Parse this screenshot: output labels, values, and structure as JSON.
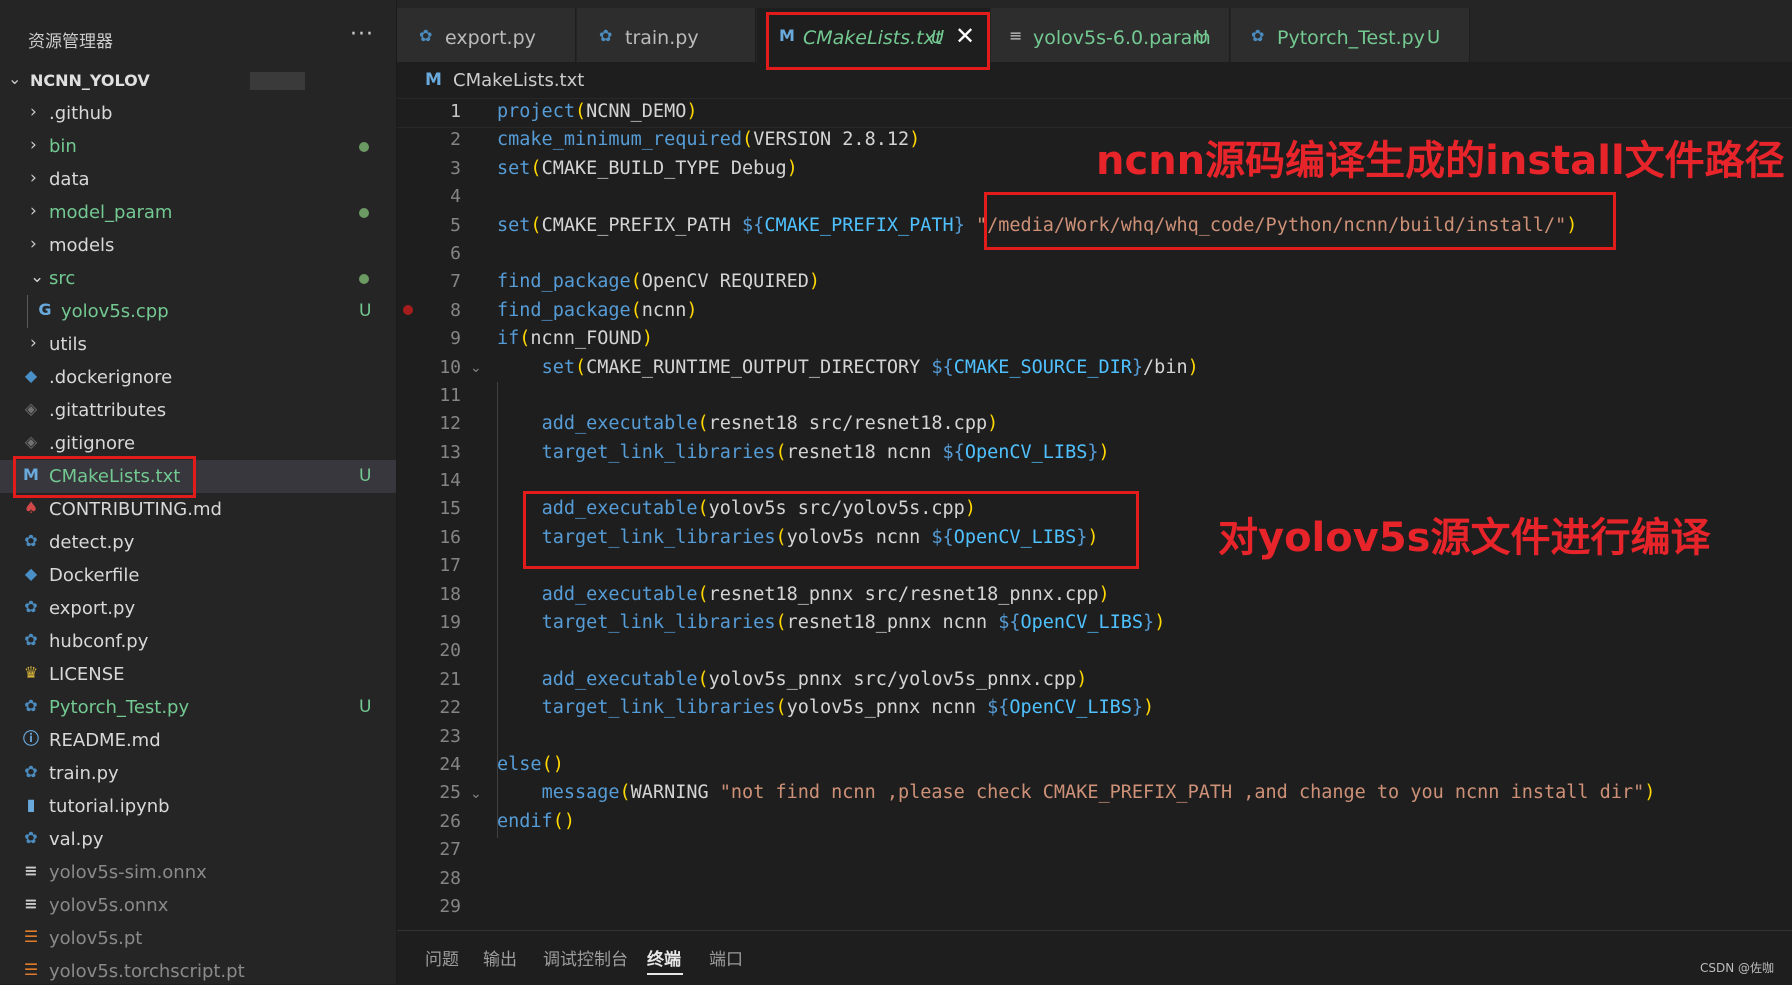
{
  "sidebar": {
    "title": "资源管理器",
    "more": "···",
    "root": "NCNN_YOLOV",
    "items": [
      {
        "name": ".github",
        "icon": "chevron-right",
        "state": "none"
      },
      {
        "name": "bin",
        "icon": "chevron-right",
        "state": "dot"
      },
      {
        "name": "data",
        "icon": "chevron-right",
        "state": "none"
      },
      {
        "name": "model_param",
        "icon": "chevron-right",
        "state": "dot"
      },
      {
        "name": "models",
        "icon": "chevron-right",
        "state": "none"
      },
      {
        "name": "src",
        "icon": "chevron-down",
        "state": "dot"
      },
      {
        "name": "yolov5s.cpp",
        "icon": "cpp-file",
        "state": "U"
      },
      {
        "name": "utils",
        "icon": "chevron-right",
        "state": "none"
      },
      {
        "name": ".dockerignore",
        "icon": "docker-file",
        "state": "none"
      },
      {
        "name": ".gitattributes",
        "icon": "git-file",
        "state": "none"
      },
      {
        "name": ".gitignore",
        "icon": "git-file",
        "state": "none"
      },
      {
        "name": "CMakeLists.txt",
        "icon": "cmake-file",
        "state": "U"
      },
      {
        "name": "CONTRIBUTING.md",
        "icon": "ribbon-file",
        "state": "none"
      },
      {
        "name": "detect.py",
        "icon": "python-file",
        "state": "none"
      },
      {
        "name": "Dockerfile",
        "icon": "docker-file",
        "state": "none"
      },
      {
        "name": "export.py",
        "icon": "python-file",
        "state": "none"
      },
      {
        "name": "hubconf.py",
        "icon": "python-file",
        "state": "none"
      },
      {
        "name": "LICENSE",
        "icon": "license-file",
        "state": "none"
      },
      {
        "name": "Pytorch_Test.py",
        "icon": "python-file",
        "state": "U"
      },
      {
        "name": "README.md",
        "icon": "info-file",
        "state": "none"
      },
      {
        "name": "train.py",
        "icon": "python-file",
        "state": "none"
      },
      {
        "name": "tutorial.ipynb",
        "icon": "notebook-file",
        "state": "none"
      },
      {
        "name": "val.py",
        "icon": "python-file",
        "state": "none"
      },
      {
        "name": "yolov5s-sim.onnx",
        "icon": "text-file",
        "state": "none"
      },
      {
        "name": "yolov5s.onnx",
        "icon": "text-file",
        "state": "none"
      },
      {
        "name": "yolov5s.pt",
        "icon": "rss-file",
        "state": "none"
      },
      {
        "name": "yolov5s.torchscript.pt",
        "icon": "rss-file",
        "state": "none"
      }
    ],
    "untracked_badge": "U"
  },
  "tabs": [
    {
      "label": "export.py",
      "icon": "python-file",
      "badge": ""
    },
    {
      "label": "train.py",
      "icon": "python-file",
      "badge": ""
    },
    {
      "label": "CMakeLists.txt",
      "icon": "cmake-file",
      "badge": "U",
      "close": "✕"
    },
    {
      "label": "yolov5s-6.0.param",
      "icon": "text-file",
      "badge": "U"
    },
    {
      "label": "Pytorch_Test.py",
      "icon": "python-file",
      "badge": "U"
    }
  ],
  "breadcrumb": {
    "icon": "M",
    "file": "CMakeLists.txt"
  },
  "editor": {
    "line_numbers": [
      "1",
      "2",
      "3",
      "4",
      "5",
      "6",
      "7",
      "8",
      "9",
      "10",
      "11",
      "12",
      "13",
      "14",
      "15",
      "16",
      "17",
      "18",
      "19",
      "20",
      "21",
      "22",
      "23",
      "24",
      "25",
      "26",
      "27",
      "28",
      "29"
    ],
    "lines": [
      [
        [
          "kw",
          "project"
        ],
        [
          "gd",
          "("
        ],
        [
          "t",
          "NCNN_DEMO"
        ],
        [
          "gd",
          ")"
        ]
      ],
      [
        [
          "kw",
          "cmake_minimum_required"
        ],
        [
          "gd",
          "("
        ],
        [
          "t",
          "VERSION 2.8.12"
        ],
        [
          "gd",
          ")"
        ]
      ],
      [
        [
          "kw",
          "set"
        ],
        [
          "gd",
          "("
        ],
        [
          "t",
          "CMAKE_BUILD_TYPE Debug"
        ],
        [
          "gd",
          ")"
        ]
      ],
      [],
      [
        [
          "kw",
          "set"
        ],
        [
          "gd",
          "("
        ],
        [
          "t",
          "CMAKE_PREFIX_PATH "
        ],
        [
          "kw",
          "${"
        ],
        [
          "vr",
          "CMAKE_PREFIX_PATH"
        ],
        [
          "kw",
          "}"
        ],
        [
          "t",
          " "
        ],
        [
          "st",
          "\"/media/Work/whq/whq_code/Python/ncnn/build/install/\""
        ],
        [
          "gd",
          ")"
        ]
      ],
      [],
      [
        [
          "kw",
          "find_package"
        ],
        [
          "gd",
          "("
        ],
        [
          "t",
          "OpenCV REQUIRED"
        ],
        [
          "gd",
          ")"
        ]
      ],
      [
        [
          "kw",
          "find_package"
        ],
        [
          "gd",
          "("
        ],
        [
          "t",
          "ncnn"
        ],
        [
          "gd",
          ")"
        ]
      ],
      [
        [
          "kw",
          "if"
        ],
        [
          "gd",
          "("
        ],
        [
          "t",
          "ncnn_FOUND"
        ],
        [
          "gd",
          ")"
        ]
      ],
      [
        [
          "t",
          "    "
        ],
        [
          "kw",
          "set"
        ],
        [
          "gd",
          "("
        ],
        [
          "t",
          "CMAKE_RUNTIME_OUTPUT_DIRECTORY "
        ],
        [
          "kw",
          "${"
        ],
        [
          "vr",
          "CMAKE_SOURCE_DIR"
        ],
        [
          "kw",
          "}"
        ],
        [
          "t",
          "/bin"
        ],
        [
          "gd",
          ")"
        ]
      ],
      [],
      [
        [
          "t",
          "    "
        ],
        [
          "kw",
          "add_executable"
        ],
        [
          "gd",
          "("
        ],
        [
          "t",
          "resnet18 src/resnet18.cpp"
        ],
        [
          "gd",
          ")"
        ]
      ],
      [
        [
          "t",
          "    "
        ],
        [
          "kw",
          "target_link_libraries"
        ],
        [
          "gd",
          "("
        ],
        [
          "t",
          "resnet18 ncnn "
        ],
        [
          "kw",
          "${"
        ],
        [
          "vr",
          "OpenCV_LIBS"
        ],
        [
          "kw",
          "}"
        ],
        [
          "gd",
          ")"
        ]
      ],
      [],
      [
        [
          "t",
          "    "
        ],
        [
          "kw",
          "add_executable"
        ],
        [
          "gd",
          "("
        ],
        [
          "t",
          "yolov5s src/yolov5s.cpp"
        ],
        [
          "gd",
          ")"
        ]
      ],
      [
        [
          "t",
          "    "
        ],
        [
          "kw",
          "target_link_libraries"
        ],
        [
          "gd",
          "("
        ],
        [
          "t",
          "yolov5s ncnn "
        ],
        [
          "kw",
          "${"
        ],
        [
          "vr",
          "OpenCV_LIBS"
        ],
        [
          "kw",
          "}"
        ],
        [
          "gd",
          ")"
        ]
      ],
      [],
      [
        [
          "t",
          "    "
        ],
        [
          "kw",
          "add_executable"
        ],
        [
          "gd",
          "("
        ],
        [
          "t",
          "resnet18_pnnx src/resnet18_pnnx.cpp"
        ],
        [
          "gd",
          ")"
        ]
      ],
      [
        [
          "t",
          "    "
        ],
        [
          "kw",
          "target_link_libraries"
        ],
        [
          "gd",
          "("
        ],
        [
          "t",
          "resnet18_pnnx ncnn "
        ],
        [
          "kw",
          "${"
        ],
        [
          "vr",
          "OpenCV_LIBS"
        ],
        [
          "kw",
          "}"
        ],
        [
          "gd",
          ")"
        ]
      ],
      [],
      [
        [
          "t",
          "    "
        ],
        [
          "kw",
          "add_executable"
        ],
        [
          "gd",
          "("
        ],
        [
          "t",
          "yolov5s_pnnx src/yolov5s_pnnx.cpp"
        ],
        [
          "gd",
          ")"
        ]
      ],
      [
        [
          "t",
          "    "
        ],
        [
          "kw",
          "target_link_libraries"
        ],
        [
          "gd",
          "("
        ],
        [
          "t",
          "yolov5s_pnnx ncnn "
        ],
        [
          "kw",
          "${"
        ],
        [
          "vr",
          "OpenCV_LIBS"
        ],
        [
          "kw",
          "}"
        ],
        [
          "gd",
          ")"
        ]
      ],
      [],
      [
        [
          "kw",
          "else"
        ],
        [
          "gd",
          "()"
        ]
      ],
      [
        [
          "t",
          "    "
        ],
        [
          "kw",
          "message"
        ],
        [
          "gd",
          "("
        ],
        [
          "t",
          "WARNING "
        ],
        [
          "st",
          "\"not find ncnn ,please check CMAKE_PREFIX_PATH ,and change to you ncnn install dir\""
        ],
        [
          "gd",
          ")"
        ]
      ],
      [
        [
          "kw",
          "endif"
        ],
        [
          "gd",
          "()"
        ]
      ],
      [],
      [],
      []
    ]
  },
  "panel": {
    "tabs": [
      "问题",
      "输出",
      "调试控制台",
      "终端",
      "端口"
    ],
    "active": "终端",
    "watermark": "CSDN @佐咖"
  },
  "annotations": {
    "install_path_note": "ncnn源码编译生成的install文件路径",
    "compile_note": "对yolov5s源文件进行编译"
  },
  "colors": {
    "annotation_red": "#e21b1b",
    "git_untracked_green": "#73c991",
    "keyword_blue": "#569cd6",
    "string_orange": "#ce9178"
  }
}
